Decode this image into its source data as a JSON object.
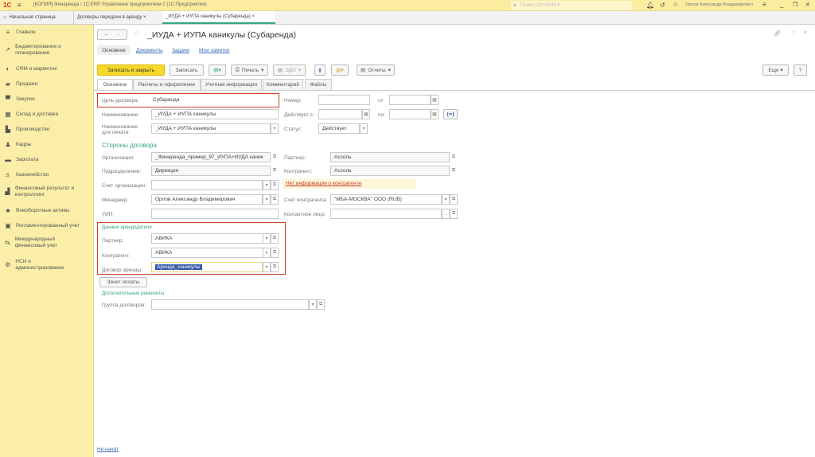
{
  "titlebar": {
    "logo": "1С",
    "title": "[КОПИЯ] Финаренда / 1С:ERP Управление предприятием 2  (1С:Предприятие)",
    "search_placeholder": "Поиск Ctrl+Shift+F",
    "user": "Орлов Александр Владимирович"
  },
  "tabs": [
    {
      "label": "Начальная страница"
    },
    {
      "label": "Договоры передачи в аренду"
    },
    {
      "label": "_ИУДА + ИУПА каникулы (Субаренда)"
    }
  ],
  "sidebar": [
    {
      "label": "Главное",
      "icon": "≡"
    },
    {
      "label": "Бюджетирование и планирование",
      "icon": "↗"
    },
    {
      "label": "CRM и маркетинг",
      "icon": "◐"
    },
    {
      "label": "Продажи",
      "icon": "▰"
    },
    {
      "label": "Закупки",
      "icon": "▀"
    },
    {
      "label": "Склад и доставка",
      "icon": "▦"
    },
    {
      "label": "Производство",
      "icon": "▙"
    },
    {
      "label": "Кадры",
      "icon": "♟"
    },
    {
      "label": "Зарплата",
      "icon": "▬"
    },
    {
      "label": "Казначейство",
      "icon": "♬"
    },
    {
      "label": "Финансовый результат и контроллинг",
      "icon": "▟"
    },
    {
      "label": "Внеоборотные активы",
      "icon": "♣"
    },
    {
      "label": "Регламентированный учет",
      "icon": "▣"
    },
    {
      "label": "Международный финансовый учет",
      "icon": "⇆"
    },
    {
      "label": "НСИ и администрирование",
      "icon": "⚙"
    }
  ],
  "form": {
    "title": "_ИУДА + ИУПА каникулы (Субаренда)",
    "nav_links": [
      "Основное",
      "Документы",
      "Задачи",
      "Мои заметки"
    ],
    "toolbar": {
      "save_close": "Записать и закрыть",
      "save": "Записать",
      "print": "Печать",
      "edo": "ЭДО",
      "reports": "Отчеты",
      "more": "Еще",
      "help": "?"
    },
    "tabs": [
      "Основное",
      "Расчеты и оформление",
      "Учетная информация",
      "Комментарий",
      "Файлы"
    ],
    "purpose_label": "Цель договора:",
    "purpose": "Субаренда",
    "name_label": "Наименование:",
    "name": "_ИУДА + ИУПА каникулы",
    "print_name_label": "Наименование для печати:",
    "print_name": "_ИУДА + ИУПА каникулы",
    "number_label": "Номер:",
    "number": "",
    "from_label": "от:",
    "from": ". .",
    "valid_from_label": "Действует с:",
    "valid_from": ". .",
    "to_label": "по:",
    "to": ". .",
    "status_label": "Статус:",
    "status": "Действует",
    "parties_header": "Стороны договора",
    "org_label": "Организация:",
    "org": "_Финаренда_пример_97_ИУПА+ИУДА каник",
    "dept_label": "Подразделение:",
    "dept": "Дирекция",
    "org_account_label": "Счет организации:",
    "org_account": "",
    "manager_label": "Менеджер:",
    "manager": "Орлов Александр Владимирович",
    "uip_label": "УИП:",
    "uip": "",
    "partner_label": "Партнер:",
    "partner": "Ассоль",
    "counterparty_label": "Контрагент:",
    "counterparty": "Ассоль",
    "no_info": "Нет информации о контрагенте",
    "cp_account_label": "Счет контрагента:",
    "cp_account": "\"МБА-МОСКВА\" ООО (RUB)",
    "contact_label": "Контактное лицо:",
    "contact": "",
    "lessor_header": "Данные арендодателя",
    "lessor_partner_label": "Партнер:",
    "lessor_partner": "АВИКА",
    "lessor_cp_label": "Контрагент:",
    "lessor_cp": "АВИКА",
    "lease_label": "Договор аренды:",
    "lease": "Аренда_каникулы",
    "offset_btn": "Зачет оплаты",
    "extra_header": "Дополнительные реквизиты",
    "group_label": "Группа договоров:",
    "group": "",
    "footer_link": "Не начат"
  }
}
